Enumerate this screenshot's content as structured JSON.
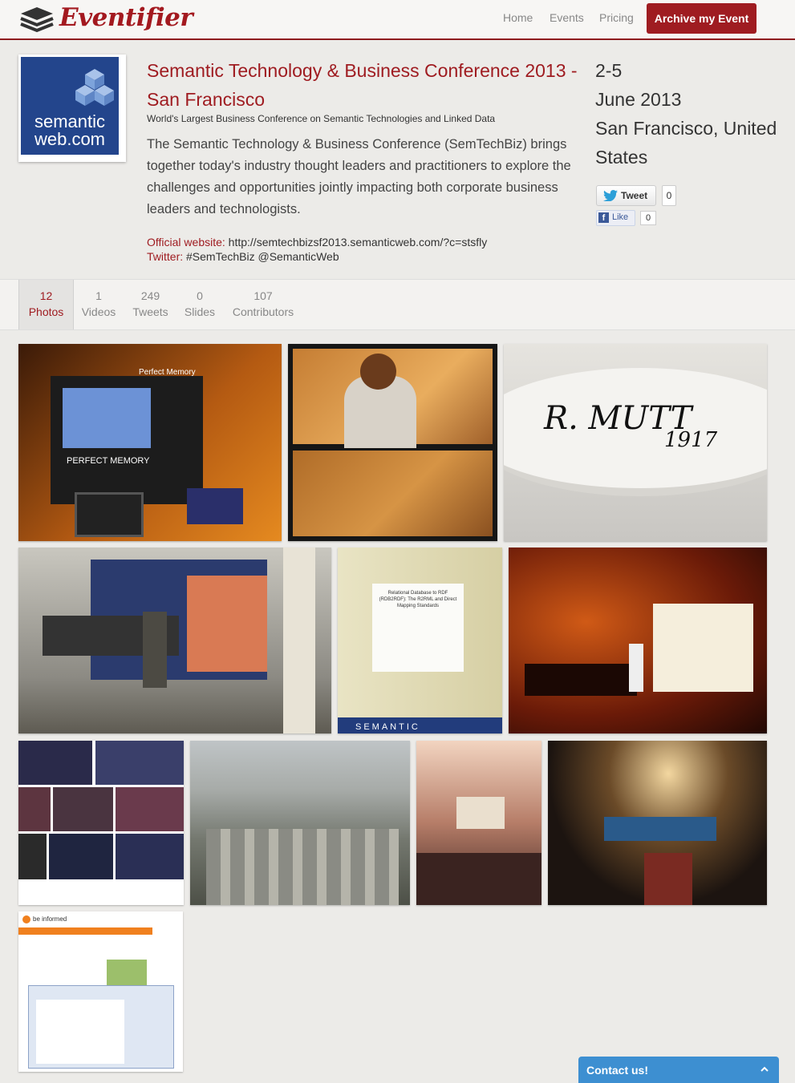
{
  "header": {
    "logo_text": "Eventifier",
    "nav": {
      "home": "Home",
      "events": "Events",
      "pricing": "Pricing"
    },
    "archive_button": "Archive my Event",
    "brand_color": "#9f1c21"
  },
  "event": {
    "thumb_text_line1": "semantic",
    "thumb_text_line2": "web.com",
    "title": "Semantic Technology & Business Conference 2013 - San Francisco",
    "subtitle": "World's Largest Business Conference on Semantic Technologies and Linked Data",
    "description": "The Semantic Technology & Business Conference (SemTechBiz) brings together today's industry thought leaders and practitioners to explore the challenges and opportunities jointly impacting both corporate business leaders and technologists.",
    "website_label": "Official website:",
    "website_value": "http://semtechbizsf2013.semanticweb.com/?c=stsfly",
    "twitter_label": "Twitter:",
    "twitter_value": "#SemTechBiz @SemanticWeb",
    "date_range": "2-5",
    "month_year": "June 2013",
    "location": "San Francisco, United States"
  },
  "social": {
    "tweet_label": "Tweet",
    "tweet_count": "0",
    "like_icon": "f",
    "like_label": "Like",
    "like_count": "0"
  },
  "tabs": [
    {
      "count": "12",
      "label": "Photos"
    },
    {
      "count": "1",
      "label": "Videos"
    },
    {
      "count": "249",
      "label": "Tweets"
    },
    {
      "count": "0",
      "label": "Slides"
    },
    {
      "count": "107",
      "label": "Contributors"
    }
  ],
  "photos": [
    {
      "caption_text": "Perfect Memory",
      "sub_text": "PERFECT MEMORY"
    },
    {
      "caption_text": ""
    },
    {
      "caption_text": "R. MUTT",
      "sub_text": "1917"
    },
    {
      "caption_text": ""
    },
    {
      "caption_text": "Relational Database to RDF (RDB2RDF): The R2RML and Direct Mapping Standards",
      "sub_text": "SEMANTIC"
    },
    {
      "caption_text": ""
    },
    {
      "caption_text": ""
    },
    {
      "caption_text": ""
    },
    {
      "caption_text": ""
    },
    {
      "caption_text": ""
    },
    {
      "caption_text": "be informed"
    }
  ],
  "contact": {
    "label": "Contact us!"
  }
}
